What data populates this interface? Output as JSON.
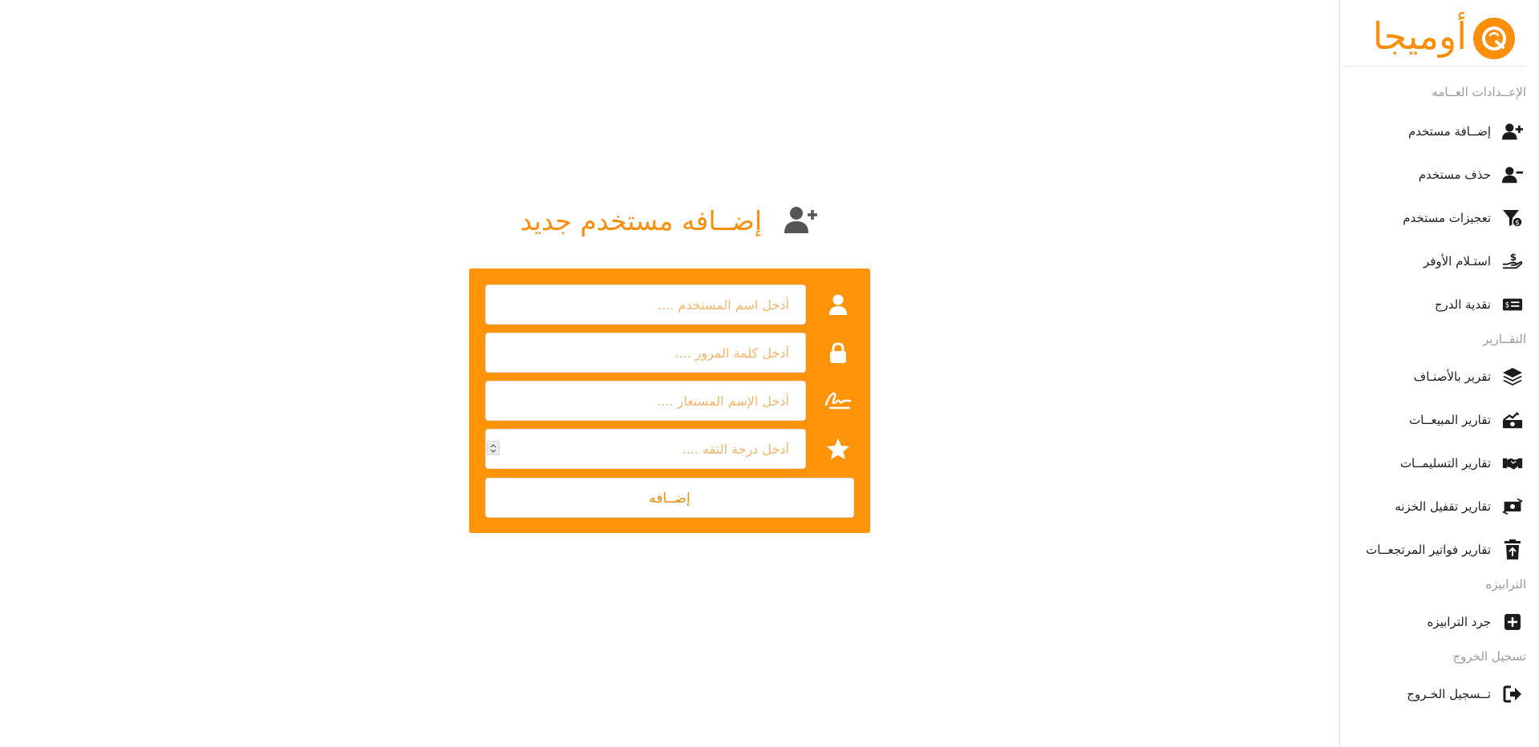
{
  "brand": {
    "name": "أوميجا",
    "color": "#fb8f0c"
  },
  "sidebar": {
    "sections": [
      {
        "heading": "الإعــدادات العــامه",
        "items": [
          {
            "label": "إضــافة مستخدم",
            "icon": "user-plus-icon"
          },
          {
            "label": "حذف مستخدم",
            "icon": "user-minus-icon"
          },
          {
            "label": "تعجيزات مستخدم",
            "icon": "funnel-dollar-icon"
          },
          {
            "label": "استـلام الأوفر",
            "icon": "hand-holding-dollar-icon"
          },
          {
            "label": "نقدية الدرج",
            "icon": "money-check-dollar-icon"
          }
        ]
      },
      {
        "heading": "التقــارير",
        "items": [
          {
            "label": "تقرير بالأصنـاف",
            "icon": "layer-group-icon"
          },
          {
            "label": "تقارير المبيعــات",
            "icon": "sack-dollar-icon"
          },
          {
            "label": "تقارير التسليمــات",
            "icon": "handshake-icon"
          },
          {
            "label": "تقارير تقفيل الخزنه",
            "icon": "money-bill-transfer-icon"
          },
          {
            "label": "تقارير فواتير المرتجعــات",
            "icon": "trash-arrow-up-icon"
          }
        ]
      },
      {
        "heading": "الترابيزه",
        "items": [
          {
            "label": "جرد الترابيزه",
            "icon": "square-plus-icon"
          }
        ]
      },
      {
        "heading": "تسجيل الخروج",
        "items": [
          {
            "label": "تــسجيل الخـروج",
            "icon": "sign-out-icon"
          }
        ]
      }
    ]
  },
  "main": {
    "title": "إضــافه مستخدم جديد",
    "title_icon": "user-plus-icon",
    "accent": "#ff9408",
    "form": {
      "fields": [
        {
          "placeholder": "أدخل اسم المستخدم ....",
          "value": "",
          "icon": "user-icon"
        },
        {
          "placeholder": "أدخل كلمة المرور ....",
          "value": "",
          "icon": "lock-icon"
        },
        {
          "placeholder": "أدخل الإسم المستعار ....",
          "value": "",
          "icon": "signature-icon"
        },
        {
          "placeholder": "أدخل درجة الثقه ....",
          "value": "",
          "icon": "star-icon"
        }
      ],
      "submit_label": "إضــافه"
    }
  }
}
